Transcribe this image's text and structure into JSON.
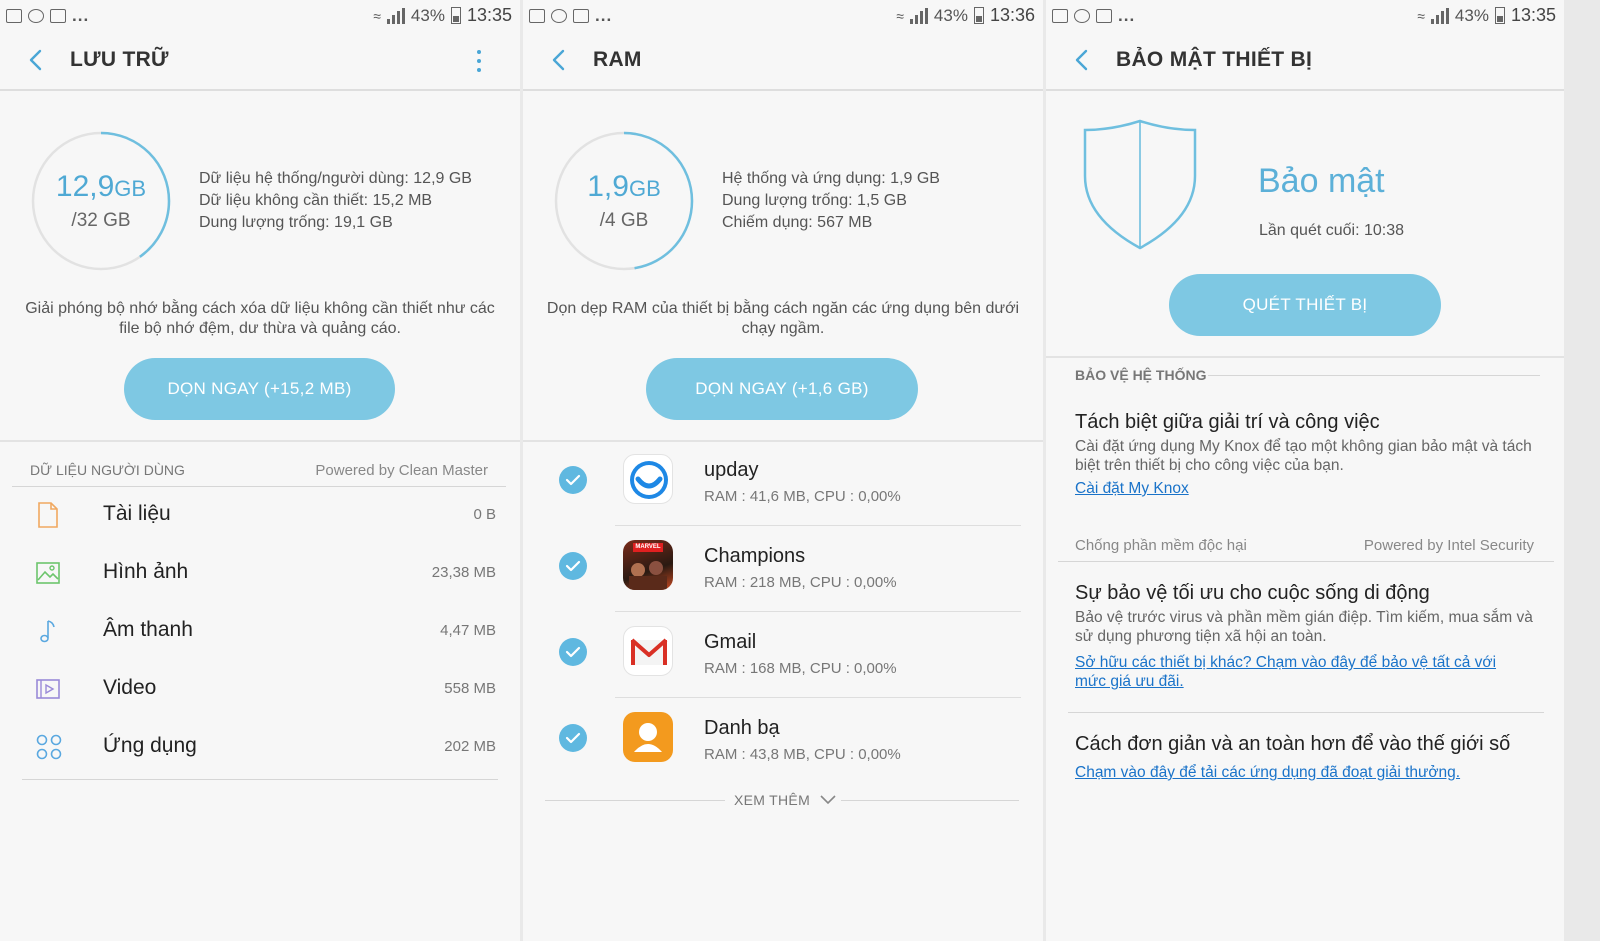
{
  "status": {
    "battery": "43%",
    "dots": "...",
    "times": [
      "13:35",
      "13:36",
      "13:35"
    ]
  },
  "storage": {
    "title": "LƯU TRỮ",
    "used_value": "12,9",
    "used_unit": "GB",
    "total": "/32 GB",
    "used_fraction": 0.403,
    "stats": [
      "Dữ liệu hệ thống/người dùng: 12,9 GB",
      "Dữ liệu không cần thiết: 15,2 MB",
      "Dung lượng trống: 19,1 GB"
    ],
    "description": "Giải phóng bộ nhớ bằng cách xóa dữ liệu không cần thiết như các file bộ nhớ đệm, dư thừa và quảng cáo.",
    "clean_button": "DỌN NGAY (+15,2 MB)",
    "section_title": "DỮ LIỆU NGƯỜI DÙNG",
    "powered_by": "Powered by Clean Master",
    "items": [
      {
        "label": "Tài liệu",
        "value": "0 B",
        "icon": "document-icon",
        "color": "#f0a860"
      },
      {
        "label": "Hình ảnh",
        "value": "23,38 MB",
        "icon": "image-icon",
        "color": "#6cc56c"
      },
      {
        "label": "Âm thanh",
        "value": "4,47 MB",
        "icon": "music-note-icon",
        "color": "#5aa8e0"
      },
      {
        "label": "Video",
        "value": "558 MB",
        "icon": "video-icon",
        "color": "#9a8ad8"
      },
      {
        "label": "Ứng dụng",
        "value": "202 MB",
        "icon": "apps-grid-icon",
        "color": "#5aa8e0"
      }
    ]
  },
  "ram": {
    "title": "RAM",
    "used_value": "1,9",
    "used_unit": "GB",
    "total": "/4 GB",
    "used_fraction": 0.475,
    "stats": [
      "Hệ thống và ứng dụng: 1,9 GB",
      "Dung lượng trống: 1,5 GB",
      "Chiếm dụng: 567 MB"
    ],
    "description": "Dọn dẹp RAM của thiết bị bằng cách ngăn các ứng dụng bên dưới chạy ngầm.",
    "clean_button": "DỌN NGAY (+1,6 GB)",
    "apps": [
      {
        "name": "upday",
        "info": "RAM : 41,6 MB, CPU : 0,00%",
        "icon": "upday-icon"
      },
      {
        "name": "Champions",
        "info": "RAM : 218 MB, CPU : 0,00%",
        "icon": "champions-icon",
        "badge": "MARVEL"
      },
      {
        "name": "Gmail",
        "info": "RAM : 168 MB, CPU : 0,00%",
        "icon": "gmail-icon"
      },
      {
        "name": "Danh bạ",
        "info": "RAM : 43,8 MB, CPU : 0,00%",
        "icon": "contacts-icon"
      }
    ],
    "see_more": "XEM THÊM"
  },
  "security": {
    "title": "BẢO MẬT THIẾT BỊ",
    "heading": "Bảo mật",
    "last_scan": "Lần quét cuối: 10:38",
    "scan_button": "QUÉT THIẾT BỊ",
    "section_title": "BẢO VỆ HỆ THỐNG",
    "knox_title": "Tách biệt giữa giải trí và công việc",
    "knox_body": "Cài đặt ứng dụng My Knox để tạo một không gian bảo mật và tách biệt trên thiết bị cho công việc của bạn.",
    "knox_link": "Cài đặt My Knox",
    "malware_title": "Chống phần mềm độc hại",
    "powered_by": "Powered by Intel Security",
    "mobile_title": "Sự bảo vệ tối ưu cho cuộc sống di động",
    "mobile_body": "Bảo vệ trước virus và phần mềm gián điệp. Tìm kiếm, mua sắm và sử dụng phương tiện xã hội an toàn.",
    "mobile_link": "Sở hữu các thiết bị khác? Chạm vào đây để bảo vệ tất cả với mức giá ưu đãi.",
    "simple_title": "Cách đơn giản và an toàn hơn để vào thế giới số",
    "simple_link": "Chạm vào đây để tải các ứng dụng đã đoạt giải thưởng."
  },
  "colors": {
    "accent": "#7ec8e3",
    "ring": "#6fbfdf",
    "link": "#1a73c9"
  }
}
